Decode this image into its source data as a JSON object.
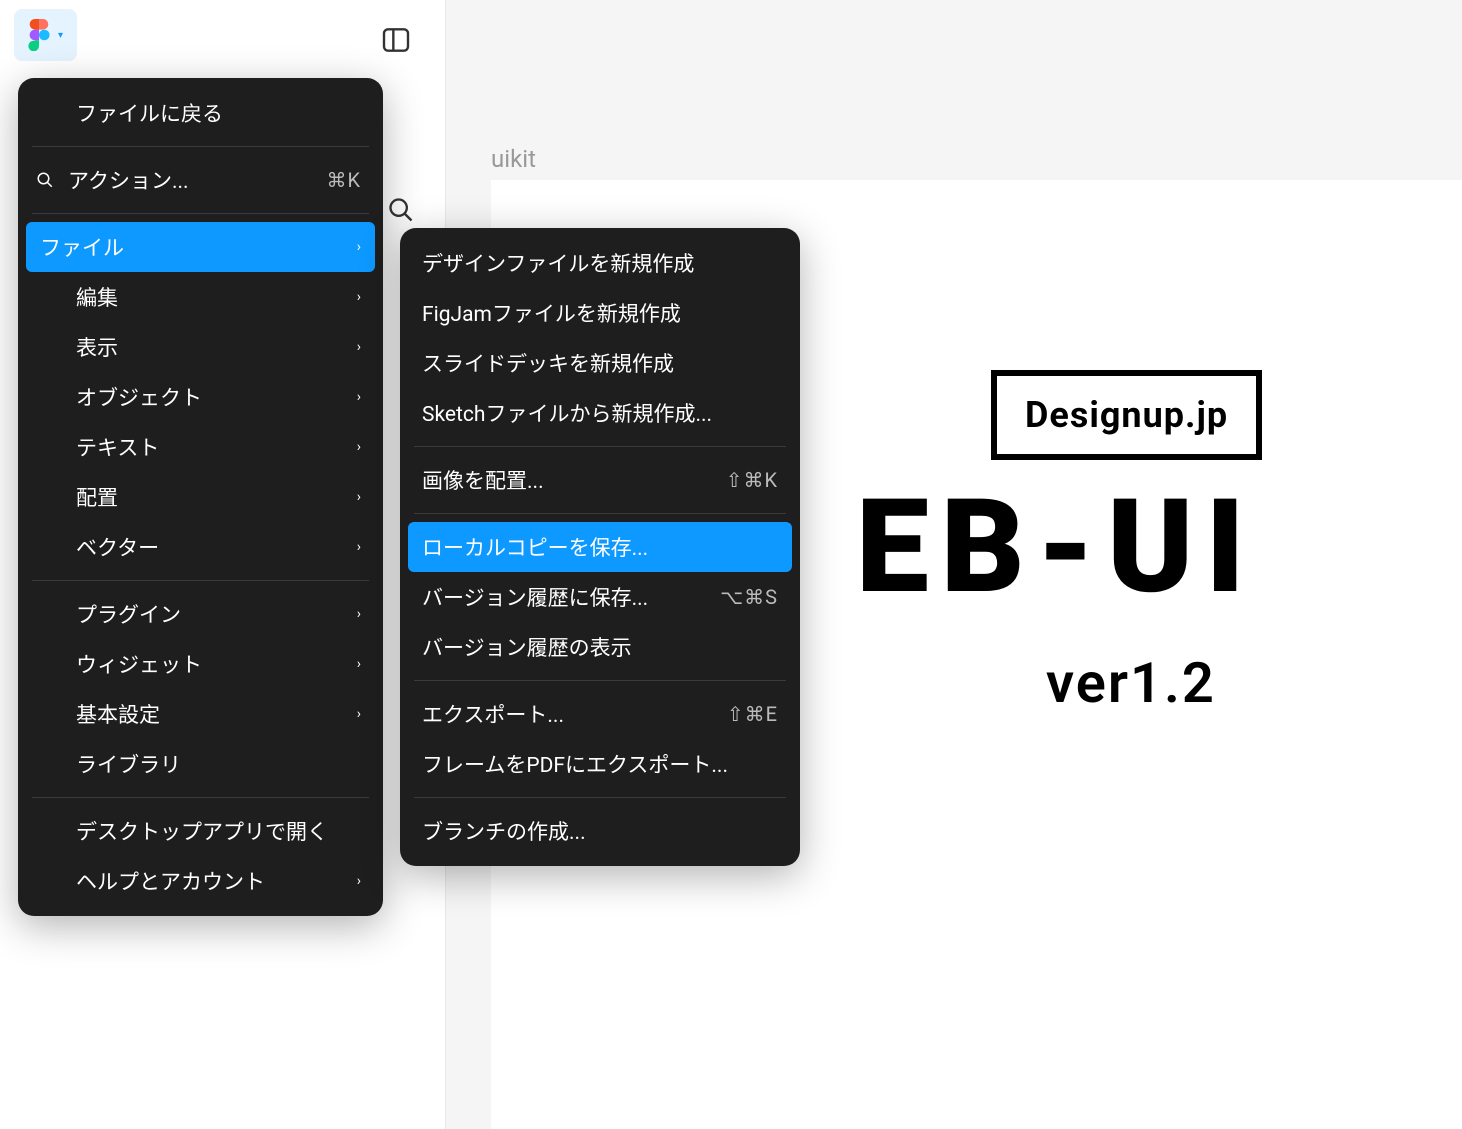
{
  "toolbar": {
    "app": "figma"
  },
  "canvas": {
    "frame_label": "uikit",
    "box_text": "Designup.jp",
    "big_text": "EB-UI",
    "version_text": "ver1.2"
  },
  "menu": {
    "back_to_files": "ファイルに戻る",
    "actions": "アクション...",
    "actions_shortcut": "⌘K",
    "file": "ファイル",
    "edit": "編集",
    "view": "表示",
    "object": "オブジェクト",
    "text": "テキスト",
    "arrange": "配置",
    "vector": "ベクター",
    "plugins": "プラグイン",
    "widgets": "ウィジェット",
    "preferences": "基本設定",
    "libraries": "ライブラリ",
    "open_desktop": "デスクトップアプリで開く",
    "help_account": "ヘルプとアカウント"
  },
  "submenu": {
    "new_design_file": "デザインファイルを新規作成",
    "new_figjam_file": "FigJamファイルを新規作成",
    "new_slide_deck": "スライドデッキを新規作成",
    "new_from_sketch": "Sketchファイルから新規作成...",
    "place_image": "画像を配置...",
    "place_image_shortcut": "⇧⌘K",
    "save_local_copy": "ローカルコピーを保存...",
    "save_version_history": "バージョン履歴に保存...",
    "save_version_shortcut": "⌥⌘S",
    "show_version_history": "バージョン履歴の表示",
    "export": "エクスポート...",
    "export_shortcut": "⇧⌘E",
    "export_frames_pdf": "フレームをPDFにエクスポート...",
    "create_branch": "ブランチの作成..."
  }
}
